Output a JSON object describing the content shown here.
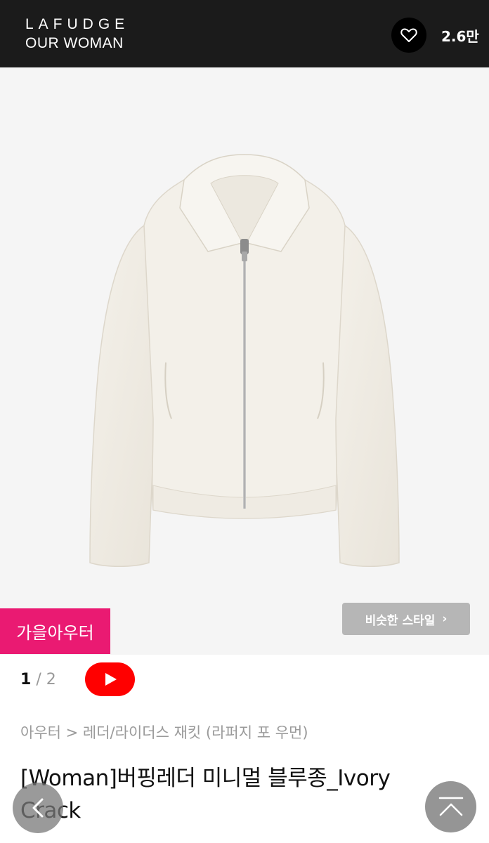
{
  "header": {
    "brand_line1": "LAFUDGE",
    "brand_line2": "OUR WOMAN",
    "like_count": "2.6만",
    "heart_icon": "heart-outline-icon"
  },
  "product_image": {
    "subject": "ivory leather zip-up collar jacket",
    "background_color": "#f5f5f5"
  },
  "tag_badge": {
    "label": "가을아우터",
    "color": "#ea1a72"
  },
  "similar_style": {
    "label": "비슷한 스타일",
    "chevron": "›"
  },
  "pager": {
    "current": "1",
    "separator": "/",
    "total": "2"
  },
  "video_button": {
    "icon": "youtube-play-icon",
    "color": "#ff0000"
  },
  "breadcrumb": "아우터 > 레더/라이더스 재킷 (라퍼지 포 우먼)",
  "product": {
    "title": "[Woman]버핑레더 미니멀 블루종_Ivory Crack"
  },
  "floating": {
    "prev_icon": "chevron-left-icon",
    "top_icon": "chevron-up-icon"
  }
}
